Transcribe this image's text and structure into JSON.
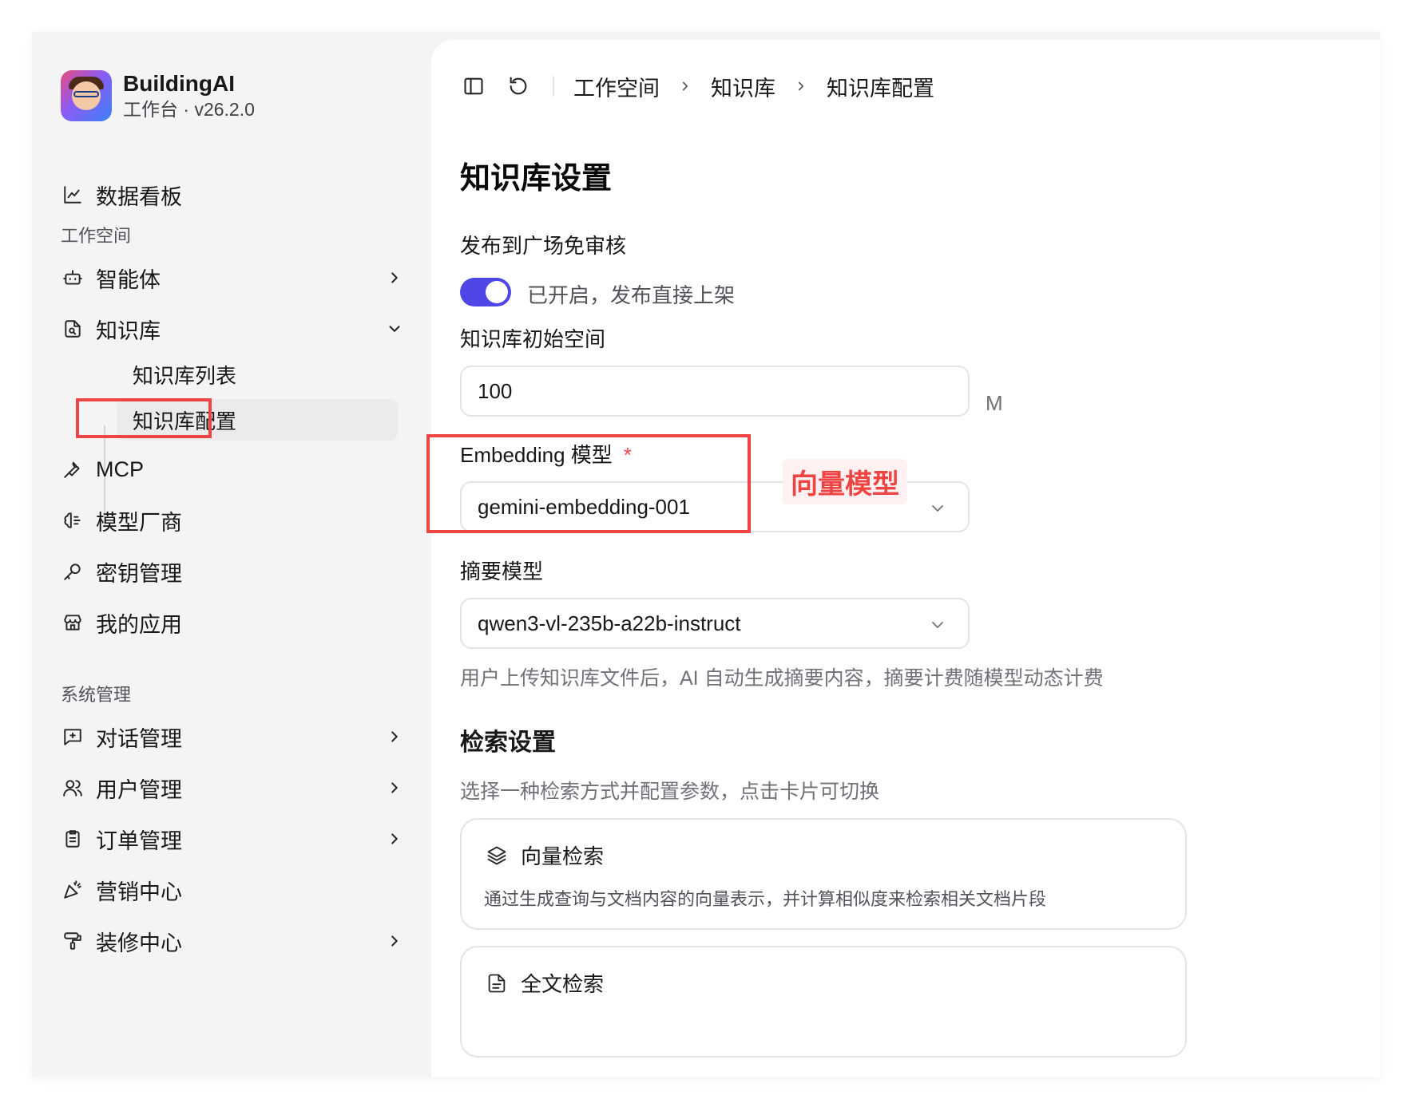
{
  "brand": {
    "name": "BuildingAI",
    "subtitle": "工作台 · v26.2.0"
  },
  "sidebar": {
    "dashboard": "数据看板",
    "workspace_label": "工作空间",
    "agents": "智能体",
    "knowledge": "知识库",
    "knowledge_sub": {
      "list": "知识库列表",
      "config": "知识库配置"
    },
    "mcp": "MCP",
    "model_vendor": "模型厂商",
    "key_mgmt": "密钥管理",
    "my_apps": "我的应用",
    "system_label": "系统管理",
    "chat_mgmt": "对话管理",
    "user_mgmt": "用户管理",
    "order_mgmt": "订单管理",
    "marketing": "营销中心",
    "decoration": "装修中心"
  },
  "breadcrumb": [
    "工作空间",
    "知识库",
    "知识库配置"
  ],
  "page": {
    "title": "知识库设置",
    "publish": {
      "label": "发布到广场免审核",
      "toggle_on": true,
      "toggle_text": "已开启，发布直接上架"
    },
    "initial_space": {
      "label": "知识库初始空间",
      "value": "100",
      "unit": "M"
    },
    "embedding": {
      "label": "Embedding 模型",
      "required_mark": "*",
      "value": "gemini-embedding-001"
    },
    "summary": {
      "label": "摘要模型",
      "value": "qwen3-vl-235b-a22b-instruct",
      "helper": "用户上传知识库文件后，AI 自动生成摘要内容，摘要计费随模型动态计费"
    },
    "retrieval": {
      "title": "检索设置",
      "helper": "选择一种检索方式并配置参数，点击卡片可切换",
      "cards": [
        {
          "title": "向量检索",
          "desc": "通过生成查询与文档内容的向量表示，并计算相似度来检索相关文档片段"
        },
        {
          "title": "全文检索",
          "desc": ""
        }
      ]
    }
  },
  "annotation": {
    "text": "向量模型",
    "color": "#ef4444"
  },
  "colors": {
    "accent": "#4f46e5",
    "highlight": "#ef4444"
  }
}
